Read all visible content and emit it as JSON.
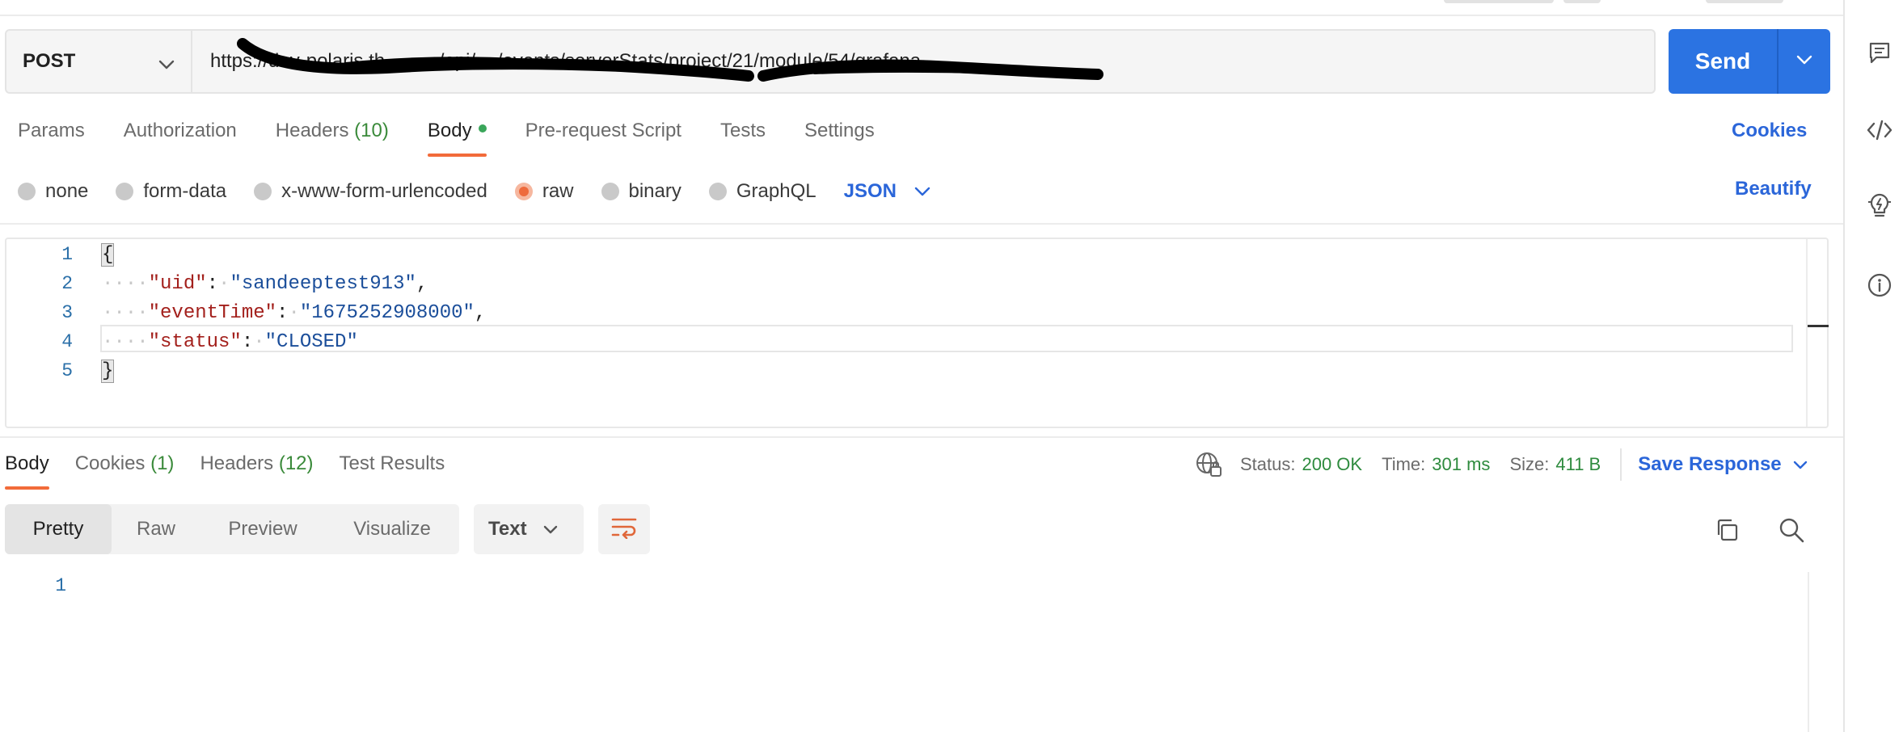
{
  "request": {
    "method": "POST",
    "url": "https://dev-polaris.th........../api/..../events/serverStats/project/21/module/54/grafana",
    "url_ellipsis": "...",
    "send_label": "Send"
  },
  "request_tabs": [
    {
      "label": "Params"
    },
    {
      "label": "Authorization"
    },
    {
      "label": "Headers",
      "count": "(10)"
    },
    {
      "label": "Body",
      "active": true
    },
    {
      "label": "Pre-request Script"
    },
    {
      "label": "Tests"
    },
    {
      "label": "Settings"
    }
  ],
  "cookies_link": "Cookies",
  "body_types": [
    {
      "label": "none"
    },
    {
      "label": "form-data"
    },
    {
      "label": "x-www-form-urlencoded"
    },
    {
      "label": "raw",
      "selected": true
    },
    {
      "label": "binary"
    },
    {
      "label": "GraphQL"
    }
  ],
  "body_format": "JSON",
  "beautify_label": "Beautify",
  "editor": {
    "line_numbers": [
      "1",
      "2",
      "3",
      "4",
      "5"
    ],
    "open_brace": "{",
    "close_brace": "}",
    "fields": [
      {
        "key": "\"uid\"",
        "value": "\"sandeeptest913\"",
        "comma": ","
      },
      {
        "key": "\"eventTime\"",
        "value": "\"1675252908000\"",
        "comma": ","
      },
      {
        "key": "\"status\"",
        "value": "\"CLOSED\"",
        "comma": ""
      }
    ]
  },
  "response_tabs": [
    {
      "label": "Body",
      "active": true
    },
    {
      "label": "Cookies",
      "count": "(1)"
    },
    {
      "label": "Headers",
      "count": "(12)"
    },
    {
      "label": "Test Results"
    }
  ],
  "response_meta": {
    "status_label": "Status:",
    "status_value": "200 OK",
    "time_label": "Time:",
    "time_value": "301 ms",
    "size_label": "Size:",
    "size_value": "411 B",
    "save_response": "Save Response"
  },
  "response_view": {
    "modes": [
      "Pretty",
      "Raw",
      "Preview",
      "Visualize"
    ],
    "active_mode": "Pretty",
    "format": "Text",
    "line_numbers": [
      "1"
    ]
  },
  "colors": {
    "accent_orange": "#f26b3a",
    "primary_blue": "#2b73e2",
    "link_blue": "#2b66d9",
    "success_green": "#2e8b3e"
  }
}
